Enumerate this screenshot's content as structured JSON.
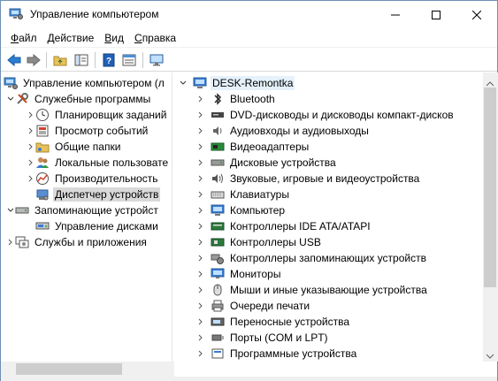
{
  "window": {
    "title": "Управление компьютером"
  },
  "menu": [
    {
      "hotkey": "Ф",
      "rest": "айл"
    },
    {
      "hotkey": "Д",
      "rest": "ействие"
    },
    {
      "hotkey": "В",
      "rest": "ид"
    },
    {
      "hotkey": "С",
      "rest": "правка"
    }
  ],
  "left_tree": {
    "root": "Управление компьютером (л",
    "items": [
      {
        "label": "Служебные программы",
        "icon": "tools-icon"
      },
      {
        "label": "Планировщик заданий",
        "icon": "clock-icon"
      },
      {
        "label": "Просмотр событий",
        "icon": "event-viewer-icon"
      },
      {
        "label": "Общие папки",
        "icon": "shared-folder-icon"
      },
      {
        "label": "Локальные пользовате",
        "icon": "users-icon"
      },
      {
        "label": "Производительность",
        "icon": "performance-icon"
      },
      {
        "label": "Диспетчер устройств",
        "icon": "device-manager-icon"
      },
      {
        "label": "Запоминающие устройст",
        "icon": "storage-icon"
      },
      {
        "label": "Управление дисками",
        "icon": "disk-management-icon"
      },
      {
        "label": "Службы и приложения",
        "icon": "services-icon"
      }
    ]
  },
  "right_tree": {
    "root": "DESK-Remontka",
    "items": [
      {
        "label": "Bluetooth",
        "icon": "bluetooth-icon"
      },
      {
        "label": "DVD-дисководы и дисководы компакт-дисков",
        "icon": "dvd-drive-icon"
      },
      {
        "label": "Аудиовходы и аудиовыходы",
        "icon": "audio-io-icon"
      },
      {
        "label": "Видеоадаптеры",
        "icon": "video-adapter-icon"
      },
      {
        "label": "Дисковые устройства",
        "icon": "disk-drive-icon"
      },
      {
        "label": "Звуковые, игровые и видеоустройства",
        "icon": "sound-icon"
      },
      {
        "label": "Клавиатуры",
        "icon": "keyboard-icon"
      },
      {
        "label": "Компьютер",
        "icon": "computer-icon"
      },
      {
        "label": "Контроллеры IDE ATA/ATAPI",
        "icon": "ide-controller-icon"
      },
      {
        "label": "Контроллеры USB",
        "icon": "usb-controller-icon"
      },
      {
        "label": "Контроллеры запоминающих устройств",
        "icon": "storage-controller-icon"
      },
      {
        "label": "Мониторы",
        "icon": "monitor-icon"
      },
      {
        "label": "Мыши и иные указывающие устройства",
        "icon": "mouse-icon"
      },
      {
        "label": "Очереди печати",
        "icon": "print-queue-icon"
      },
      {
        "label": "Переносные устройства",
        "icon": "portable-device-icon"
      },
      {
        "label": "Порты (COM и LPT)",
        "icon": "port-icon"
      },
      {
        "label": "Программные устройства",
        "icon": "software-device-icon"
      }
    ]
  }
}
